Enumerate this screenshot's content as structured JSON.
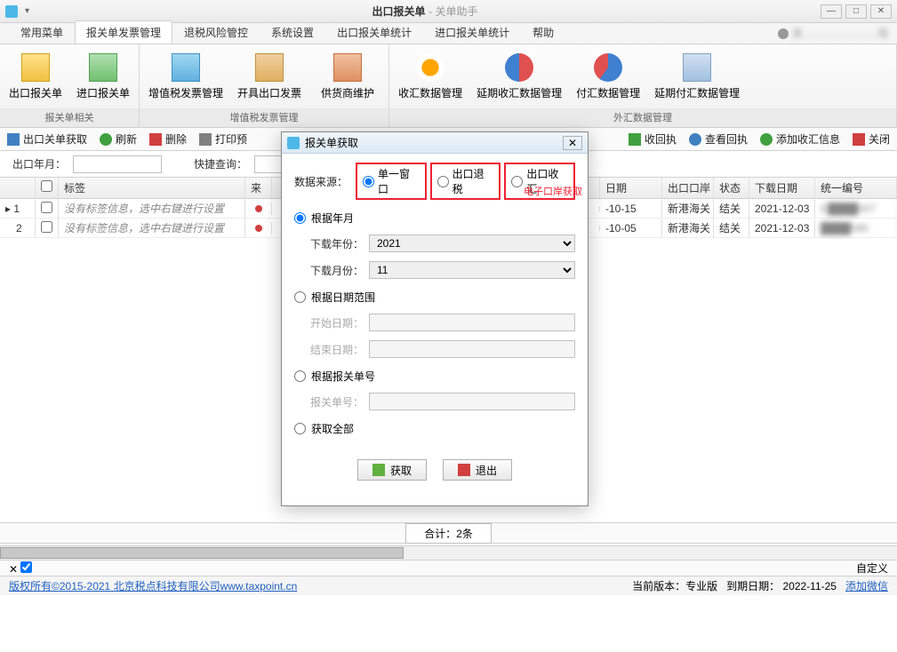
{
  "title": {
    "main": "出口报关单",
    "sub": "- 关单助手"
  },
  "user_label": "天…………………司",
  "menu_tabs": [
    "常用菜单",
    "报关单发票管理",
    "退税风险管控",
    "系统设置",
    "出口报关单统计",
    "进口报关单统计",
    "帮助"
  ],
  "active_menu": 1,
  "ribbon": {
    "groups": [
      {
        "label": "报关单相关",
        "items": [
          "出口报关单",
          "进口报关单"
        ]
      },
      {
        "label": "增值税发票管理",
        "items": [
          "增值税发票管理",
          "开具出口发票",
          "供货商维护"
        ]
      },
      {
        "label": "外汇数据管理",
        "items": [
          "收汇数据管理",
          "延期收汇数据管理",
          "付汇数据管理",
          "延期付汇数据管理"
        ]
      }
    ]
  },
  "toolbar": {
    "fetch": "出口关单获取",
    "refresh": "刷新",
    "delete": "删除",
    "print": "打印预",
    "receipt": "收回执",
    "view": "查看回执",
    "add": "添加收汇信息",
    "close": "关闭"
  },
  "filter": {
    "year_label": "出口年月：",
    "quick_label": "快捷查询："
  },
  "grid": {
    "headers": {
      "tag": "标签",
      "src": "来",
      "date": "日期",
      "port": "出口口岸",
      "status": "状态",
      "dl": "下载日期",
      "no": "统一编号"
    },
    "rows": [
      {
        "idx": "1",
        "tag": "没有标签信息，选中右键进行设置",
        "date": "-10-15",
        "port": "新港海关",
        "status": "结关",
        "dl": "2021-12-03",
        "no": "E████007"
      },
      {
        "idx": "2",
        "tag": "没有标签信息，选中右键进行设置",
        "date": "-10-05",
        "port": "新港海关",
        "status": "结关",
        "dl": "2021-12-03",
        "no": "████585"
      }
    ],
    "summary": "合计：2条"
  },
  "toggle_bar": {
    "right": "自定义"
  },
  "status": {
    "copyright": "版权所有©2015-2021 北京税点科技有限公司www.taxpoint.cn",
    "version_label": "当前版本：专业版",
    "expire_label": "到期日期：",
    "expire_date": "2022-11-25",
    "wechat": "添加微信"
  },
  "dialog": {
    "title": "报关单获取",
    "src_label": "数据来源：",
    "src_options": [
      "单一窗口",
      "出口退税",
      "出口收汇"
    ],
    "annotation": "电子口岸获取",
    "opt_year": "根据年月",
    "year_label": "下载年份：",
    "year_value": "2021",
    "month_label": "下载月份：",
    "month_value": "11",
    "opt_range": "根据日期范围",
    "start_label": "开始日期：",
    "end_label": "结束日期：",
    "opt_no": "根据报关单号",
    "no_label": "报关单号：",
    "opt_all": "获取全部",
    "btn_get": "获取",
    "btn_exit": "退出"
  }
}
